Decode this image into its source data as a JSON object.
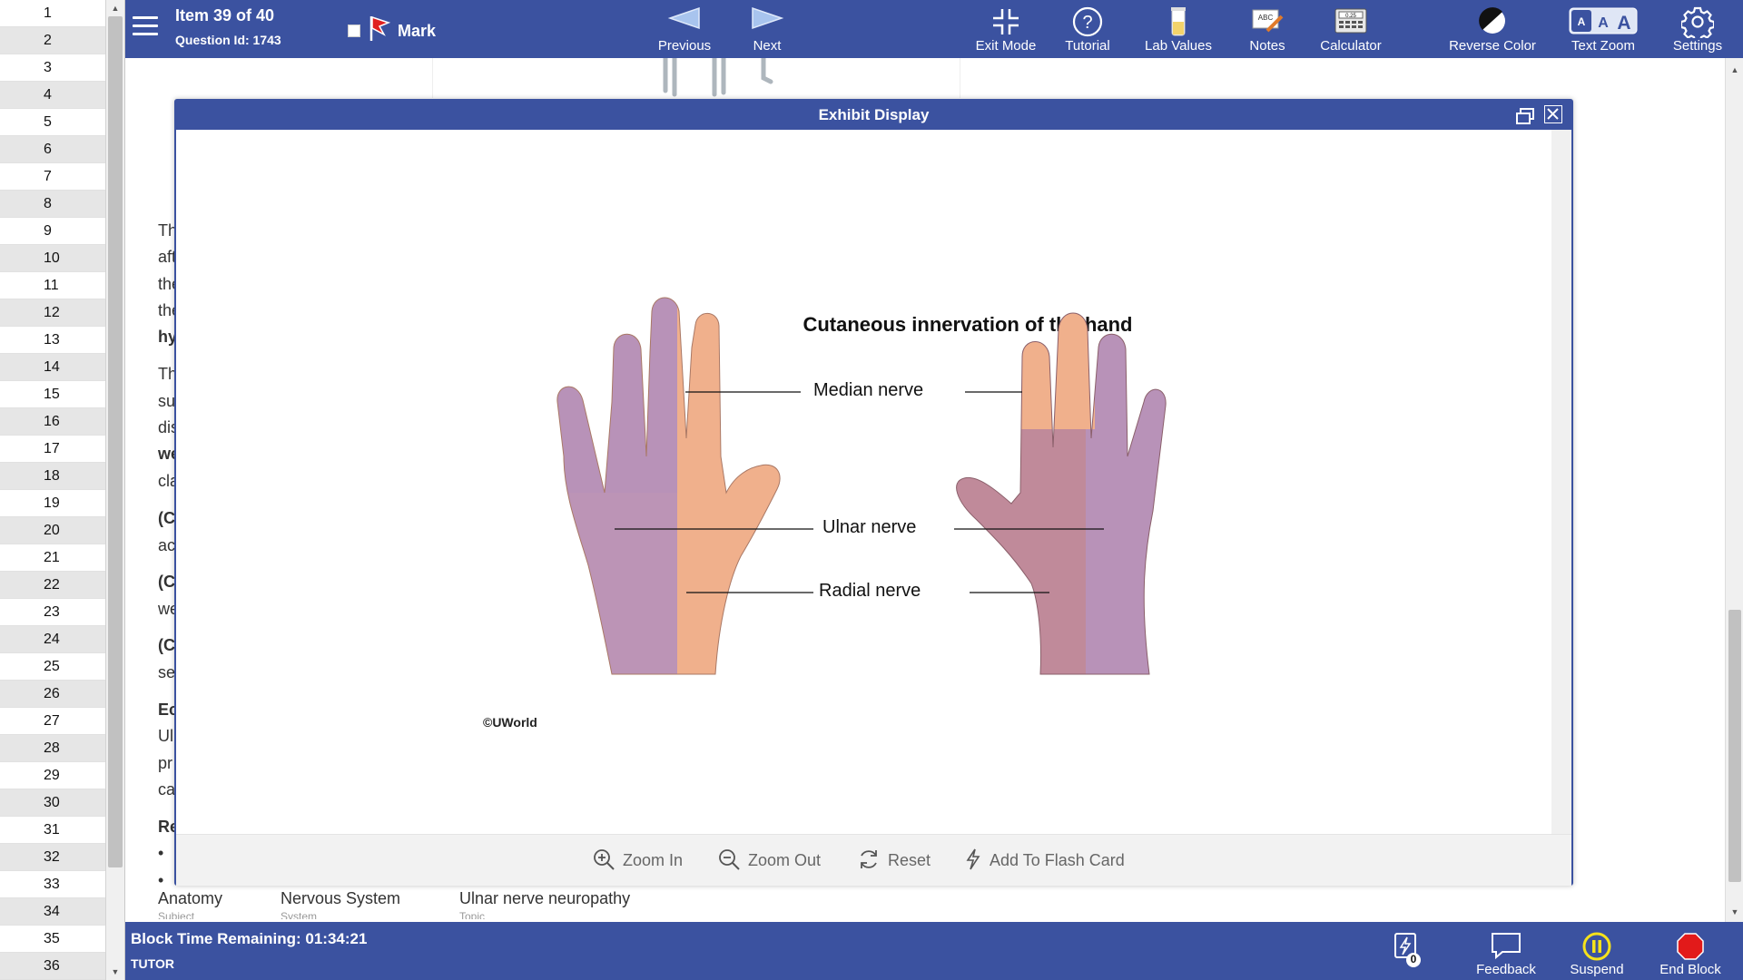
{
  "question_list": [
    "1",
    "2",
    "3",
    "4",
    "5",
    "6",
    "7",
    "8",
    "9",
    "10",
    "11",
    "12",
    "13",
    "14",
    "15",
    "16",
    "17",
    "18",
    "19",
    "20",
    "21",
    "22",
    "23",
    "24",
    "25",
    "26",
    "27",
    "28",
    "29",
    "30",
    "31",
    "32",
    "33",
    "34",
    "35",
    "36"
  ],
  "header": {
    "item_text": "Item 39 of 40",
    "question_id_text": "Question Id: 1743",
    "mark_label": "Mark",
    "previous_label": "Previous",
    "next_label": "Next",
    "exit_mode_label": "Exit Mode",
    "tutorial_label": "Tutorial",
    "lab_values_label": "Lab Values",
    "notes_label": "Notes",
    "calculator_label": "Calculator",
    "reverse_color_label": "Reverse Color",
    "text_zoom_label": "Text Zoom",
    "settings_label": "Settings",
    "calculator_display": "0.25",
    "notes_icon_text": "ABC",
    "text_zoom_letters": [
      "A",
      "A",
      "A"
    ]
  },
  "background_text": [
    {
      "text": "Th",
      "bold": false
    },
    {
      "text": "aft",
      "bold": false
    },
    {
      "text": "the",
      "bold": false
    },
    {
      "text": "the",
      "bold": false
    },
    {
      "text": "hy",
      "bold": true
    },
    {
      "text": "Th",
      "bold": false
    },
    {
      "text": "su",
      "bold": false
    },
    {
      "text": "dis",
      "bold": false
    },
    {
      "text": "we",
      "bold": true
    },
    {
      "text": "cla",
      "bold": false
    },
    {
      "text": "(C",
      "bold": true
    },
    {
      "text": "ac",
      "bold": false
    },
    {
      "text": "(C",
      "bold": true
    },
    {
      "text": "we",
      "bold": false
    },
    {
      "text": "(C",
      "bold": true
    },
    {
      "text": "se",
      "bold": false
    },
    {
      "text": "Ec",
      "bold": true
    },
    {
      "text": "Ul",
      "bold": false
    },
    {
      "text": "pr",
      "bold": false
    },
    {
      "text": "ca",
      "bold": false
    },
    {
      "text": "Re",
      "bold": true
    },
    {
      "text": "•",
      "bold": false
    },
    {
      "text": "•",
      "bold": false
    }
  ],
  "categories": [
    {
      "value": "Anatomy",
      "caption": "Subject"
    },
    {
      "value": "Nervous System",
      "caption": "System"
    },
    {
      "value": "Ulnar nerve neuropathy",
      "caption": "Topic"
    }
  ],
  "exhibit": {
    "title": "Exhibit Display",
    "figure_title": "Cutaneous innervation of the hand",
    "labels": {
      "median": "Median nerve",
      "ulnar": "Ulnar nerve",
      "radial": "Radial nerve"
    },
    "copyright": "©UWorld",
    "footer": {
      "zoom_in": "Zoom In",
      "zoom_out": "Zoom Out",
      "reset": "Reset",
      "add_flash_card": "Add To Flash Card"
    },
    "colors": {
      "median": "#f0b08c",
      "ulnar": "#b892b8",
      "radial": "#c08a9a"
    }
  },
  "footer": {
    "block_time": "Block Time Remaining: 01:34:21",
    "mode": "TUTOR",
    "flash_count": "0",
    "feedback_label": "Feedback",
    "suspend_label": "Suspend",
    "end_block_label": "End Block"
  },
  "theme": {
    "bar_color": "#3b52a0"
  }
}
